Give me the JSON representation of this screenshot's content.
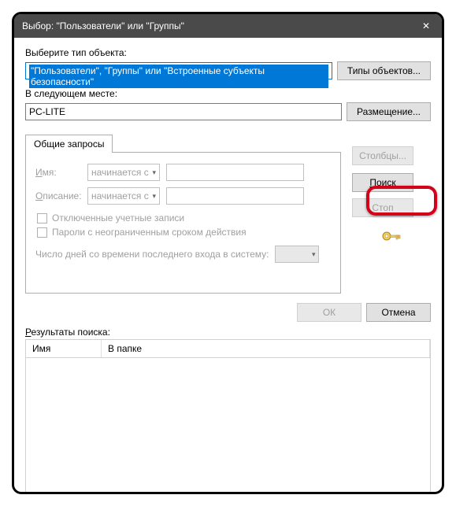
{
  "title": "Выбор: \"Пользователи\" или \"Группы\"",
  "objectType": {
    "label": "Выберите тип объекта:",
    "value": "\"Пользователи\", \"Группы\" или \"Встроенные субъекты безопасности\"",
    "button": "Типы объектов..."
  },
  "location": {
    "label": "В следующем месте:",
    "value": "PC-LITE",
    "button": "Размещение..."
  },
  "tab": "Общие запросы",
  "query": {
    "nameLabel": "Имя:",
    "descLabel": "Описание:",
    "startsWith": "начинается с",
    "chkDisabled": "Отключенные учетные записи",
    "chkPassword": "Пароли с неограниченным сроком действия",
    "daysLabel": "Число дней со времени последнего входа в систему:"
  },
  "sideButtons": {
    "columns": "Столбцы...",
    "search": "Поиск",
    "stop": "Стоп"
  },
  "bottom": {
    "ok": "ОК",
    "cancel": "Отмена"
  },
  "results": {
    "label": "Результаты поиска:",
    "col1": "Имя",
    "col2": "В папке"
  }
}
